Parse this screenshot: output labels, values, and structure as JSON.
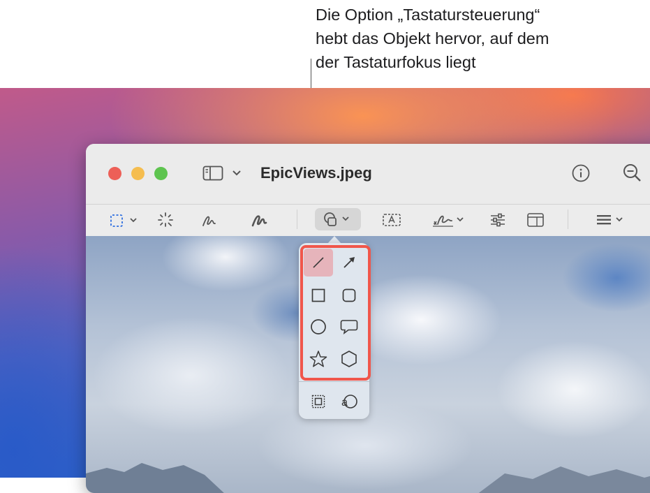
{
  "callout": {
    "lines": [
      "Die Option „Tastatursteuerung“",
      "hebt das Objekt hervor, auf dem",
      "der Tastaturfokus liegt"
    ]
  },
  "window": {
    "title": "EpicViews.jpeg",
    "traffic_lights": {
      "close": "#ed5f57",
      "minimize": "#f5bd4f",
      "zoom": "#5ec44f"
    },
    "titlebar_icons": [
      "sidebar-icon",
      "chevron-down-icon",
      "info-icon",
      "zoom-out-icon"
    ],
    "markup_toolbar": [
      "selection-tool-icon",
      "instant-alpha-icon",
      "sketch-icon",
      "draw-icon",
      "shapes-icon",
      "text-icon",
      "sign-icon",
      "adjust-color-icon",
      "page-layout-icon",
      "border-style-icon"
    ]
  },
  "shapes_popover": {
    "focused_item": "line",
    "highlight_color": "#f0564b",
    "items": [
      "line-icon",
      "arrow-icon",
      "rectangle-icon",
      "rounded-rectangle-icon",
      "oval-icon",
      "speech-bubble-icon",
      "star-icon",
      "polygon-icon"
    ],
    "footer_items": [
      "mask-icon",
      "loupe-icon"
    ]
  }
}
